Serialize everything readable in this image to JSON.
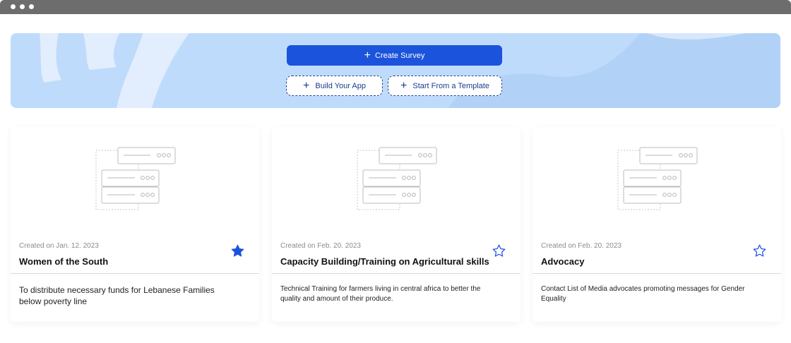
{
  "actions": {
    "create_survey": "Create Survey",
    "build_app": "Build Your App",
    "start_template": "Start From a Template"
  },
  "colors": {
    "primary": "#1b53dc",
    "banner": "#bfdbfb",
    "star_active": "#1b53dc"
  },
  "cards": [
    {
      "created": "Created on Jan. 12. 2023",
      "title": "Women of the South",
      "description": "To distribute necessary funds for Lebanese Families below poverty line",
      "favorite": true
    },
    {
      "created": "Created on Feb. 20. 2023",
      "title": "Capacity Building/Training on Agricultural skills",
      "description": "Technical Training for farmers living in central africa to better the quality and amount of their produce.",
      "favorite": false
    },
    {
      "created": "Created on Feb. 20. 2023",
      "title": "Advocacy",
      "description": "Contact List of Media advocates promoting messages for Gender Equality",
      "favorite": false
    }
  ]
}
